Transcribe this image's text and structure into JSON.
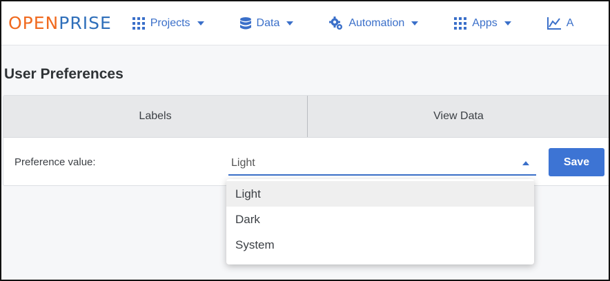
{
  "logo": {
    "part1": "OPEN",
    "part2": "PRISE"
  },
  "nav": [
    {
      "label": "Projects",
      "icon": "grid-icon"
    },
    {
      "label": "Data",
      "icon": "database-icon"
    },
    {
      "label": "Automation",
      "icon": "gear-icon"
    },
    {
      "label": "Apps",
      "icon": "grid-icon"
    },
    {
      "label": "A",
      "icon": "chart-icon"
    }
  ],
  "page": {
    "title": "User Preferences"
  },
  "tabs": [
    {
      "label": "Labels"
    },
    {
      "label": "View Data"
    }
  ],
  "form": {
    "label": "Preference value:",
    "selected": "Light",
    "save_label": "Save",
    "options": [
      "Light",
      "Dark",
      "System"
    ]
  },
  "colors": {
    "accent": "#3d74d4",
    "logo_orange": "#f06a1f",
    "logo_blue": "#2f6fba"
  }
}
